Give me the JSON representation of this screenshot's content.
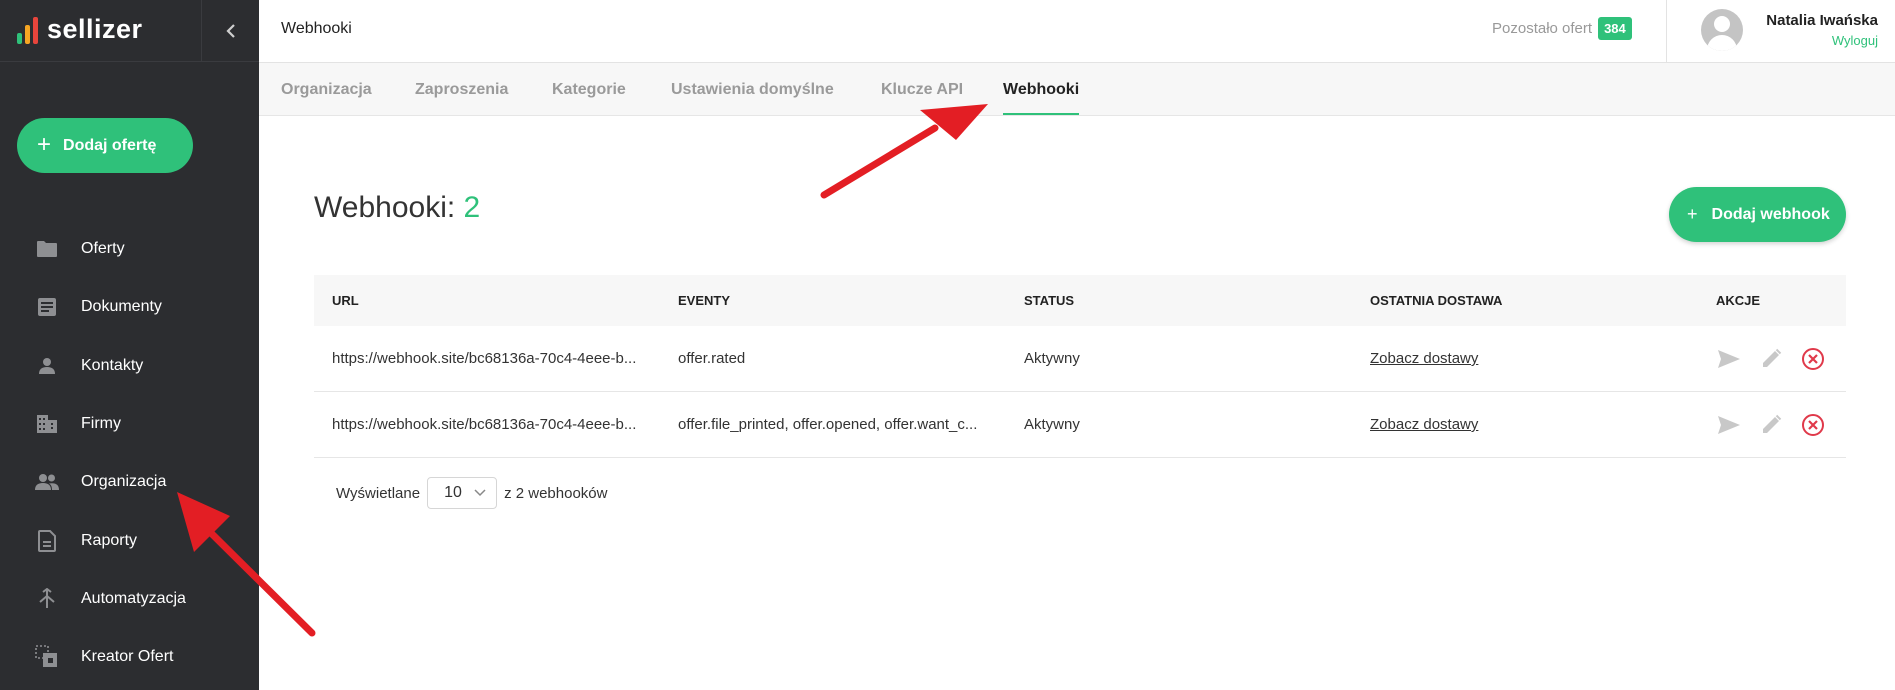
{
  "app": {
    "logo_text": "sellizer"
  },
  "sidebar": {
    "add_offer_label": "Dodaj ofertę",
    "items": [
      {
        "label": "Oferty",
        "icon": "folder-icon"
      },
      {
        "label": "Dokumenty",
        "icon": "document-icon"
      },
      {
        "label": "Kontakty",
        "icon": "person-icon"
      },
      {
        "label": "Firmy",
        "icon": "building-icon"
      },
      {
        "label": "Organizacja",
        "icon": "people-icon"
      },
      {
        "label": "Raporty",
        "icon": "report-icon"
      },
      {
        "label": "Automatyzacja",
        "icon": "automation-icon"
      },
      {
        "label": "Kreator Ofert",
        "icon": "offer-creator-icon"
      }
    ]
  },
  "header": {
    "title": "Webhooki",
    "remaining_label": "Pozostało ofert",
    "remaining_count": "384",
    "user_name": "Natalia Iwańska",
    "logout_label": "Wyloguj"
  },
  "tabs": [
    {
      "label": "Organizacja",
      "active": false
    },
    {
      "label": "Zaproszenia",
      "active": false
    },
    {
      "label": "Kategorie",
      "active": false
    },
    {
      "label": "Ustawienia domyślne",
      "active": false
    },
    {
      "label": "Klucze API",
      "active": false
    },
    {
      "label": "Webhooki",
      "active": true
    }
  ],
  "main": {
    "heading": "Webhooki:",
    "heading_count": "2",
    "add_webhook_label": "Dodaj webhook",
    "columns": [
      "URL",
      "EVENTY",
      "STATUS",
      "OSTATNIA DOSTAWA",
      "AKCJE"
    ],
    "rows": [
      {
        "url": "https://webhook.site/bc68136a-70c4-4eee-b...",
        "events": "offer.rated",
        "status": "Aktywny",
        "last_delivery": "Zobacz dostawy"
      },
      {
        "url": "https://webhook.site/bc68136a-70c4-4eee-b...",
        "events": "offer.file_printed, offer.opened, offer.want_c...",
        "status": "Aktywny",
        "last_delivery": "Zobacz dostawy"
      }
    ],
    "pagination": {
      "shown_label": "Wyświetlane",
      "per_page": "10",
      "total_label": "z 2 webhooków"
    }
  },
  "colors": {
    "accent": "#2fc17a",
    "sidebar_bg": "#2c2d30",
    "danger": "#e0394a",
    "annotation_arrow": "#e31e24"
  }
}
